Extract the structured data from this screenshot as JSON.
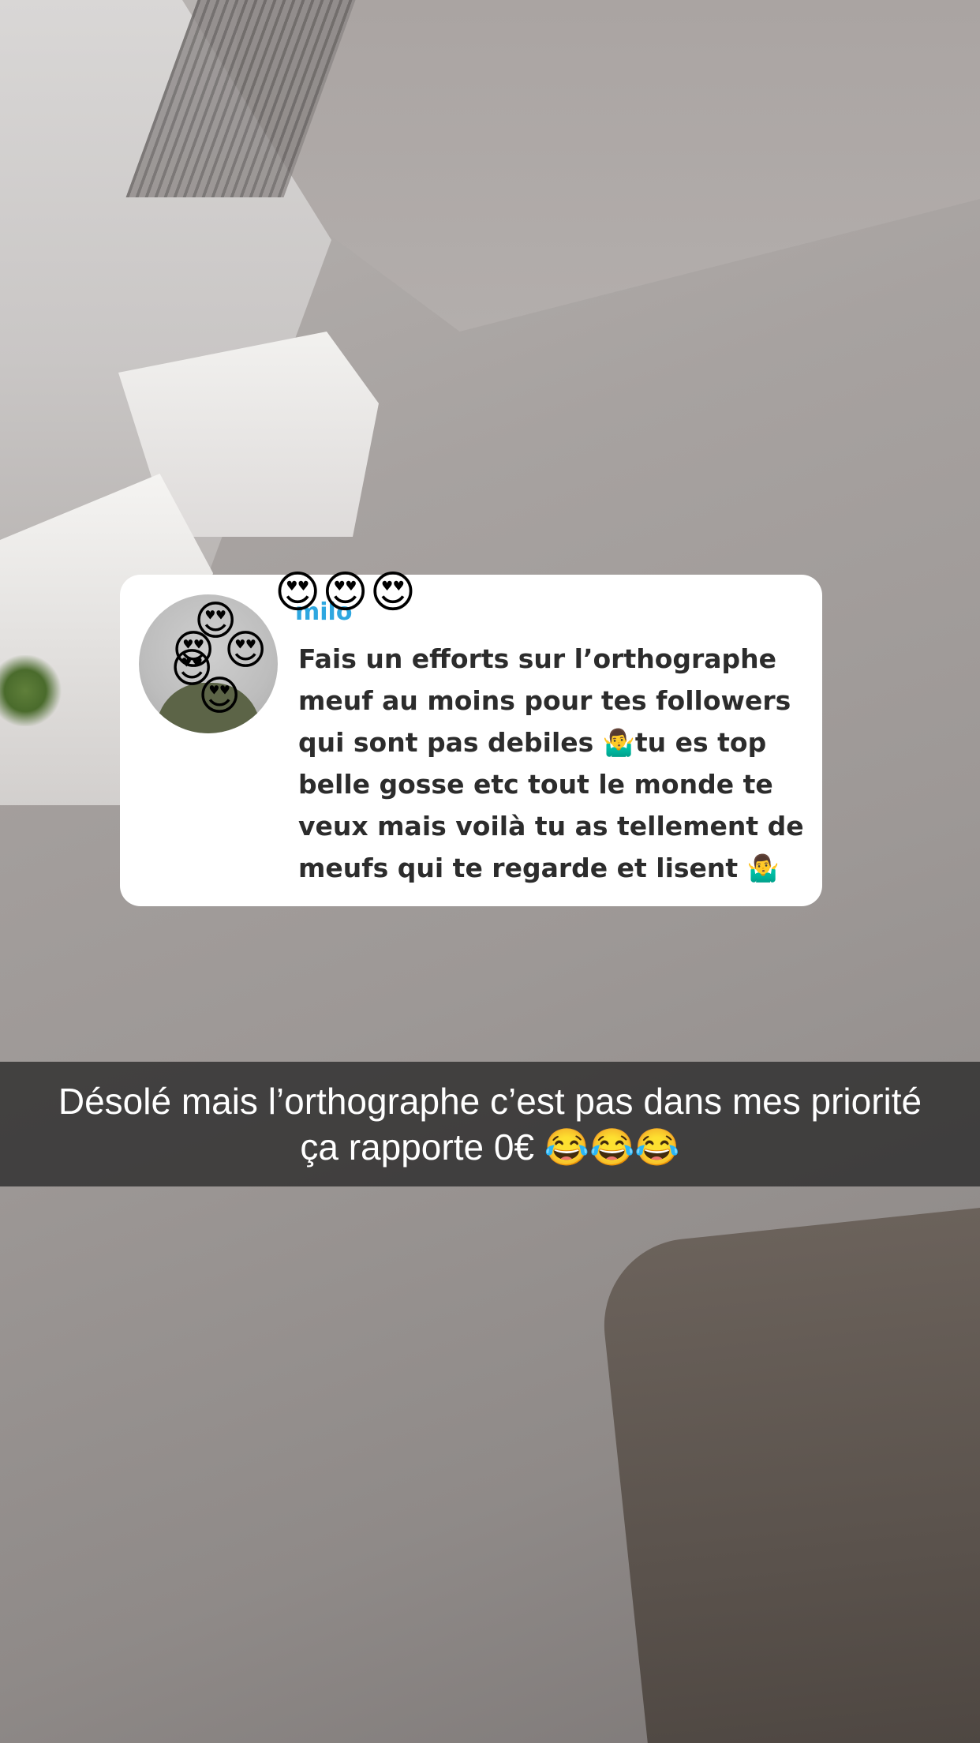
{
  "question": {
    "username": "milo",
    "username_emojis": "😍😍😍",
    "avatar_emojis": [
      "😍",
      "😍",
      "😍",
      "😍",
      "😍"
    ],
    "text": "Fais un efforts sur l’orthographe\nmeuf au moins pour tes followers\nqui sont pas debiles 🤷‍♂️tu es top\nbelle gosse etc tout le monde te\nveux mais voilà tu as tellement de\nmeufs qui te regarde et lisent 🤷‍♂️"
  },
  "caption": {
    "text": "Désolé mais l’orthographe c’est pas dans mes priorité\nça rapporte 0€ 😂😂😂"
  }
}
